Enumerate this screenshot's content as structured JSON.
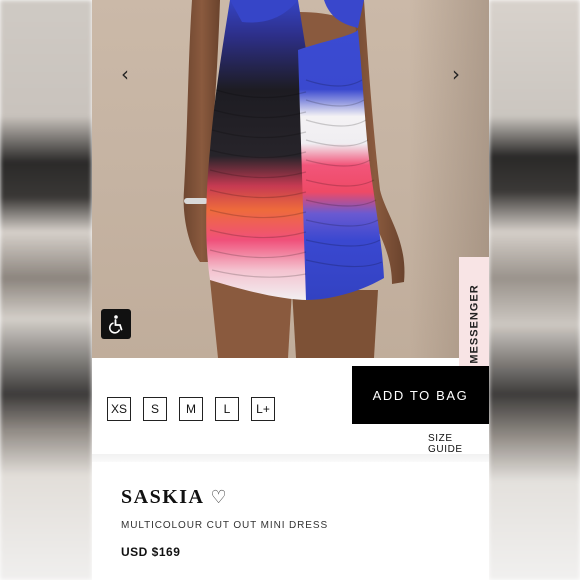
{
  "product": {
    "name": "SASKIA",
    "subtitle": "MULTICOLOUR CUT OUT MINI DRESS",
    "price": "USD $169",
    "favorite_icon": "heart-outline-icon"
  },
  "gallery": {
    "prev_icon": "chevron-left-icon",
    "next_icon": "chevron-right-icon",
    "prev_glyph": "‹",
    "next_glyph": "›"
  },
  "accessibility": {
    "icon": "wheelchair-accessibility-icon"
  },
  "messenger": {
    "label": "MESSENGER"
  },
  "sizes": [
    "XS",
    "S",
    "M",
    "L",
    "L+"
  ],
  "actions": {
    "add_to_bag": "ADD TO BAG",
    "size_guide": "SIZE GUIDE"
  },
  "colors": {
    "dress_blue": "#3647c9",
    "dress_black": "#1c1b22",
    "dress_pink": "#f2537a",
    "dress_orange": "#f0743a",
    "dress_white": "#f3f1f3",
    "button_black": "#000000",
    "messenger_bg": "#f8e4e5"
  }
}
